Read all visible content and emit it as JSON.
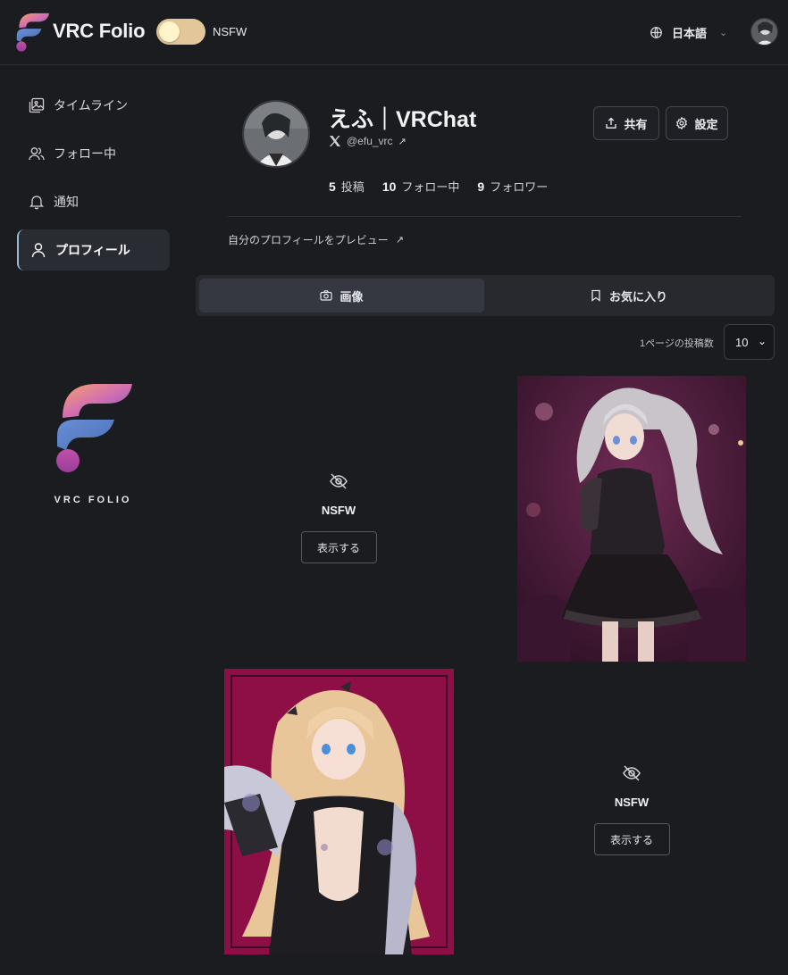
{
  "header": {
    "brand": "VRC Folio",
    "nsfw_label": "NSFW",
    "nsfw_toggle_on": true,
    "language": "日本語"
  },
  "sidebar": {
    "items": [
      {
        "label": "タイムライン",
        "icon": "image-stack-icon",
        "active": false
      },
      {
        "label": "フォロー中",
        "icon": "users-icon",
        "active": false
      },
      {
        "label": "通知",
        "icon": "bell-icon",
        "active": false
      },
      {
        "label": "プロフィール",
        "icon": "user-icon",
        "active": true
      }
    ],
    "logo_text": "VRC FOLIO"
  },
  "profile": {
    "name": "えふ｜VRChat",
    "handle": "@efu_vrc",
    "stats": [
      {
        "count": "5",
        "label": "投稿"
      },
      {
        "count": "10",
        "label": "フォロー中"
      },
      {
        "count": "9",
        "label": "フォロワー"
      }
    ],
    "share_label": "共有",
    "settings_label": "設定",
    "preview_link": "自分のプロフィールをプレビュー"
  },
  "tabs": [
    {
      "label": "画像",
      "icon": "camera-icon",
      "active": true
    },
    {
      "label": "お気に入り",
      "icon": "bookmark-icon",
      "active": false
    }
  ],
  "pagination": {
    "per_page_label": "1ページの投稿数",
    "per_page_value": "10"
  },
  "posts": [
    {
      "type": "nsfw-hidden",
      "label": "NSFW",
      "button": "表示する"
    },
    {
      "type": "image",
      "subject": "avatar-white-hair-dark-dress"
    },
    {
      "type": "image",
      "subject": "avatar-blonde-kimono"
    },
    {
      "type": "nsfw-hidden",
      "label": "NSFW",
      "button": "表示する"
    }
  ],
  "colors": {
    "background": "#1b1c20",
    "toggle_on": "#e3c79a",
    "active_nav_accent": "#9fb8d6",
    "logo_gradient_top": "#f08a5d",
    "logo_gradient_bottom": "#7a4fa8"
  }
}
